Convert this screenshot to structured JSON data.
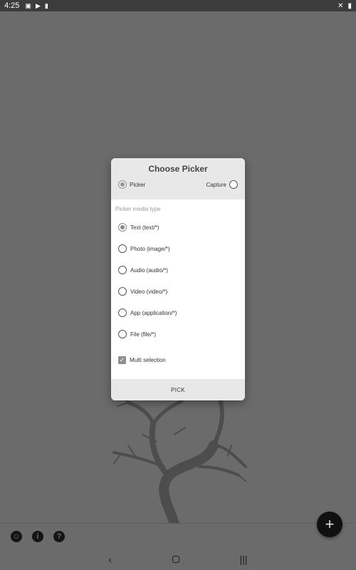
{
  "status_bar": {
    "time": "4:25",
    "left_icons": [
      "image-icon",
      "play-store-icon",
      "sd-card-icon"
    ],
    "right_icons": [
      "mute-icon",
      "battery-icon"
    ]
  },
  "dialog": {
    "title": "Choose Picker",
    "modes": {
      "picker_label": "Picker",
      "capture_label": "Capture",
      "selected": "Picker"
    },
    "section_label": "Picker media type",
    "media_types": [
      {
        "label": "Text (text/*)",
        "checked": true
      },
      {
        "label": "Photo (image/*)",
        "checked": false
      },
      {
        "label": "Audio (audio/*)",
        "checked": false
      },
      {
        "label": "Video (video/*)",
        "checked": false
      },
      {
        "label": "App (application/*)",
        "checked": false
      },
      {
        "label": "File (file/*)",
        "checked": false
      }
    ],
    "multi_selection_label": "Multi selection",
    "multi_selection_checked": true,
    "pick_label": "PICK"
  },
  "bottom_bar": {
    "icons": [
      "face-icon",
      "info-icon",
      "help-icon"
    ],
    "fab_label": "+"
  },
  "nav_bar": {
    "back": "‹",
    "recents": "|||"
  }
}
